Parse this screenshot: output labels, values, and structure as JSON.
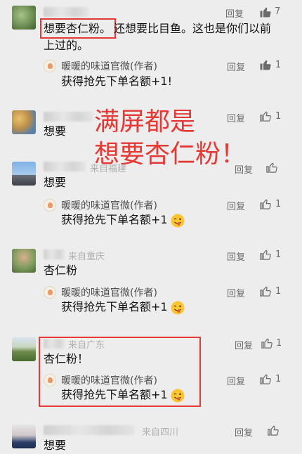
{
  "overlay": {
    "line1": "满屏都是",
    "line2": "想要杏仁粉！"
  },
  "reply_label": "回复",
  "comments": [
    {
      "location": "",
      "text_highlight": "想要杏仁粉。",
      "text_rest": "还想要比目鱼。这也是你们以前",
      "text_line2": "上过的。",
      "likes": "7",
      "reply": {
        "author": "暖暖的味道官微(作者)",
        "text": "获得抢先下单名额+1!",
        "likes": "1"
      }
    },
    {
      "location": "",
      "text": "想要",
      "likes": "1"
    },
    {
      "location": "来自福建",
      "text": "想要",
      "likes": "",
      "reply": {
        "author": "暖暖的味道官微(作者)",
        "text": "获得抢先下单名额+1",
        "likes": "1"
      }
    },
    {
      "location": "来自重庆",
      "text": "杏仁粉",
      "likes": "1",
      "reply": {
        "author": "暖暖的味道官微(作者)",
        "text": "获得抢先下单名额+1",
        "likes": "1"
      }
    },
    {
      "location": "来自广东",
      "text": "杏仁粉！",
      "likes": "1",
      "reply": {
        "author": "暖暖的味道官微(作者)",
        "text": "获得抢先下单名额+1",
        "likes": "1"
      }
    },
    {
      "location": "来自四川",
      "text": "想要",
      "likes": ""
    }
  ]
}
